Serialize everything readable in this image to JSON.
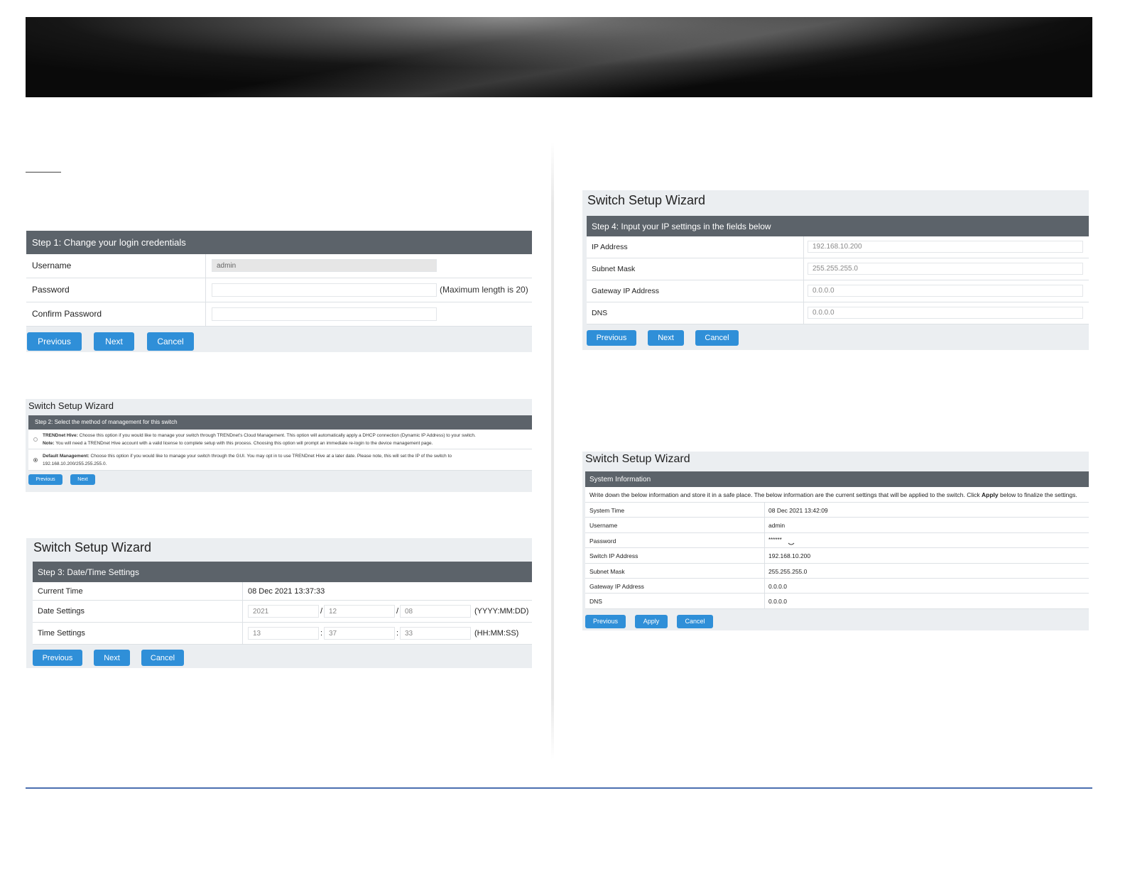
{
  "step1": {
    "header": "Step 1: Change your login credentials",
    "rows": [
      {
        "label": "Username",
        "value": "admin"
      },
      {
        "label": "Password",
        "value": ""
      },
      {
        "label": "Confirm Password",
        "value": ""
      }
    ],
    "password_hint": "(Maximum length is 20)",
    "buttons": {
      "previous": "Previous",
      "next": "Next",
      "cancel": "Cancel"
    }
  },
  "step2": {
    "title": "Switch Setup Wizard",
    "header": "Step 2: Select the method of management for this switch",
    "options": [
      {
        "name": "TRENDnet Hive:",
        "text": "Choose this option if you would like to manage your switch through TRENDnet's Cloud Management. This option will automatically apply a DHCP connection (Dynamic IP Address) to your switch.",
        "note_label": "Note:",
        "note_text": "You will need a TRENDnet Hive account with a valid license to complete setup with this process. Choosing this option will prompt an immediate re-login to the device management page.",
        "selected": false
      },
      {
        "name": "Default Management:",
        "text": "Choose this option if you would like to manage your switch through the GUI. You may opt in to use TRENDnet Hive at a later date. Please note, this will set the IP of the switch to 192.168.10.200/255.255.255.0.",
        "selected": true
      }
    ],
    "buttons": {
      "previous": "Previous",
      "next": "Next"
    }
  },
  "step3": {
    "title": "Switch Setup Wizard",
    "header": "Step 3: Date/Time Settings",
    "current_time_label": "Current Time",
    "current_time": "08 Dec 2021 13:37:33",
    "date_label": "Date Settings",
    "date": {
      "year": "2021",
      "month": "12",
      "day": "08",
      "sep": "/",
      "format": "(YYYY:MM:DD)"
    },
    "time_label": "Time Settings",
    "time": {
      "hour": "13",
      "minute": "37",
      "second": "33",
      "sep": ":",
      "format": "(HH:MM:SS)"
    },
    "buttons": {
      "previous": "Previous",
      "next": "Next",
      "cancel": "Cancel"
    }
  },
  "step4": {
    "title": "Switch Setup Wizard",
    "header": "Step 4: Input your IP settings in the fields below",
    "rows": [
      {
        "label": "IP Address",
        "value": "192.168.10.200"
      },
      {
        "label": "Subnet Mask",
        "value": "255.255.255.0"
      },
      {
        "label": "Gateway IP Address",
        "value": "0.0.0.0"
      },
      {
        "label": "DNS",
        "value": "0.0.0.0"
      }
    ],
    "buttons": {
      "previous": "Previous",
      "next": "Next",
      "cancel": "Cancel"
    }
  },
  "summary": {
    "title": "Switch Setup Wizard",
    "header": "System Information",
    "note_before": "Write down the below information and store it in a safe place. The below information are the current settings that will be applied to the switch. Click",
    "note_bold": "Apply",
    "note_after": "below to finalize the settings.",
    "rows": [
      {
        "label": "System Time",
        "value": "08 Dec 2021 13:42:09"
      },
      {
        "label": "Username",
        "value": "admin"
      },
      {
        "label": "Password",
        "value": "******"
      },
      {
        "label": "Switch IP Address",
        "value": "192.168.10.200"
      },
      {
        "label": "Subnet Mask",
        "value": "255.255.255.0"
      },
      {
        "label": "Gateway IP Address",
        "value": "0.0.0.0"
      },
      {
        "label": "DNS",
        "value": "0.0.0.0"
      }
    ],
    "buttons": {
      "previous": "Previous",
      "apply": "Apply",
      "cancel": "Cancel"
    }
  }
}
